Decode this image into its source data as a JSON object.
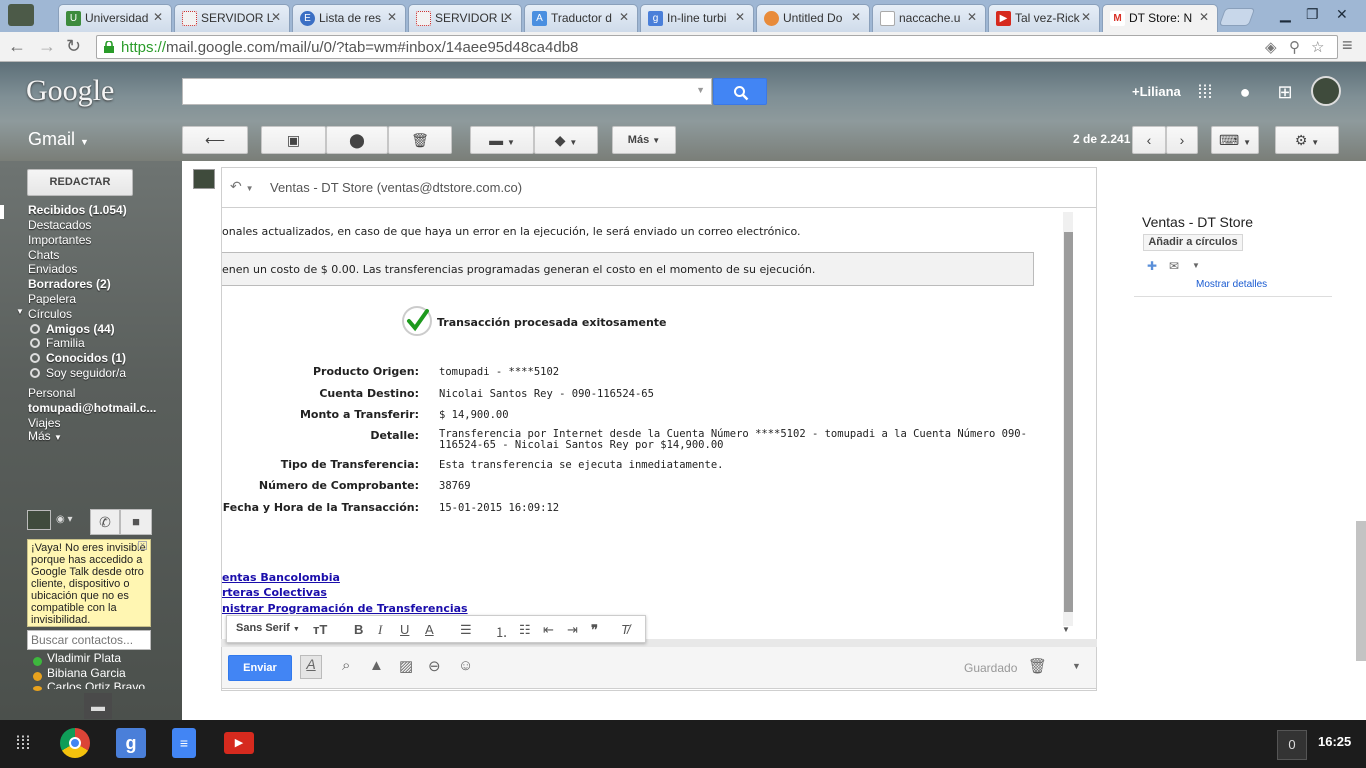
{
  "browser": {
    "tabs": [
      {
        "label": "Universidad",
        "icon_color": "#3d8b3d",
        "icon": "UN"
      },
      {
        "label": "SERVIDOR L",
        "icon_color": "#f2f2f2",
        "icon": ""
      },
      {
        "label": "Lista de res",
        "icon_color": "#3b6fc4",
        "icon": "E"
      },
      {
        "label": "SERVIDOR L",
        "icon_color": "#f2f2f2",
        "icon": ""
      },
      {
        "label": "Traductor d",
        "icon_color": "#4a8fe0",
        "icon": "A"
      },
      {
        "label": "In-line turbi",
        "icon_color": "#4a7fd9",
        "icon": "g"
      },
      {
        "label": "Untitled Do",
        "icon_color": "#e88b3a",
        "icon": ""
      },
      {
        "label": "naccache.u",
        "icon_color": "#ffffff",
        "icon": ""
      },
      {
        "label": "Tal vez-Rick",
        "icon_color": "#d62a1e",
        "icon": "▶"
      },
      {
        "label": "DT Store: N",
        "icon_color": "#d93025",
        "icon": "M"
      }
    ],
    "url_https": "https://",
    "url_rest": "mail.google.com/mail/u/0/?tab=wm#inbox/14aee95d48ca4db8"
  },
  "header": {
    "logo": "Google",
    "user": "+Liliana",
    "app_label": "Gmail",
    "more_label": "Más",
    "pager": "2 de 2.241"
  },
  "sidebar": {
    "compose": "REDACTAR",
    "items": [
      {
        "label": "Recibidos (1.054)",
        "bold": true
      },
      {
        "label": "Destacados",
        "bold": false
      },
      {
        "label": "Importantes",
        "bold": false
      },
      {
        "label": "Chats",
        "bold": false
      },
      {
        "label": "Enviados",
        "bold": false
      },
      {
        "label": "Borradores (2)",
        "bold": true
      },
      {
        "label": "Papelera",
        "bold": false
      },
      {
        "label": "Círculos",
        "bold": false
      },
      {
        "label": "Amigos (44)",
        "bold": true
      },
      {
        "label": "Familia",
        "bold": false
      },
      {
        "label": "Conocidos (1)",
        "bold": true
      },
      {
        "label": "Soy seguidor/a",
        "bold": false
      },
      {
        "label": "Personal",
        "bold": false
      },
      {
        "label": "tomupadi@hotmail.c...",
        "bold": true
      },
      {
        "label": "Viajes",
        "bold": false
      },
      {
        "label": "Más",
        "bold": false
      }
    ],
    "notice": "¡Vaya! No eres invisible porque has accedido a Google Talk desde otro cliente, dispositivo o ubicación que no es compatible con la invisibilidad.",
    "contact_search_placeholder": "Buscar contactos...",
    "contacts": [
      {
        "name": "Vladimir Plata",
        "status_color": "#3db83d"
      },
      {
        "name": "Bibiana Garcia",
        "status_color": "#e8a21d"
      },
      {
        "name": "Carlos Ortiz Bravo",
        "status_color": "#e8a21d"
      }
    ]
  },
  "message": {
    "reply_to": "Ventas - DT Store (ventas@dtstore.com.co)",
    "line1": "onales actualizados, en caso de que haya un error en la ejecución, le será enviado un correo electrónico.",
    "line2": "enen un costo de $ 0.00. Las transferencias programadas generan el costo en el momento de su ejecución.",
    "success": "Transacción procesada exitosamente",
    "details": [
      {
        "label": "Producto Origen:",
        "value": "tomupadi - ****5102"
      },
      {
        "label": "Cuenta Destino:",
        "value": "Nicolai Santos Rey - 090-116524-65"
      },
      {
        "label": "Monto a Transferir:",
        "value": "$ 14,900.00"
      },
      {
        "label": "Detalle:",
        "value": "Transferencia por Internet desde la Cuenta Número ****5102 - tomupadi a la Cuenta Número 090-",
        "value2": "116524-65 - Nicolai Santos Rey por $14,900.00"
      },
      {
        "label": "Tipo de Transferencia:",
        "value": "Esta transferencia se ejecuta inmediatamente."
      },
      {
        "label": "Número de Comprobante:",
        "value": "38769"
      },
      {
        "label": "Fecha y Hora de la Transacción:",
        "value": "15-01-2015 16:09:12"
      }
    ],
    "links": [
      "entas Bancolombia",
      "rteras Colectivas",
      "nistrar Programación de Transferencias"
    ]
  },
  "editor": {
    "font": "Sans Serif",
    "send": "Enviar",
    "saved": "Guardado"
  },
  "contact_panel": {
    "name": "Ventas - DT Store",
    "add_circles": "Añadir a círculos",
    "more_details": "Mostrar detalles"
  },
  "taskbar": {
    "count": "0",
    "time": "16:25"
  }
}
